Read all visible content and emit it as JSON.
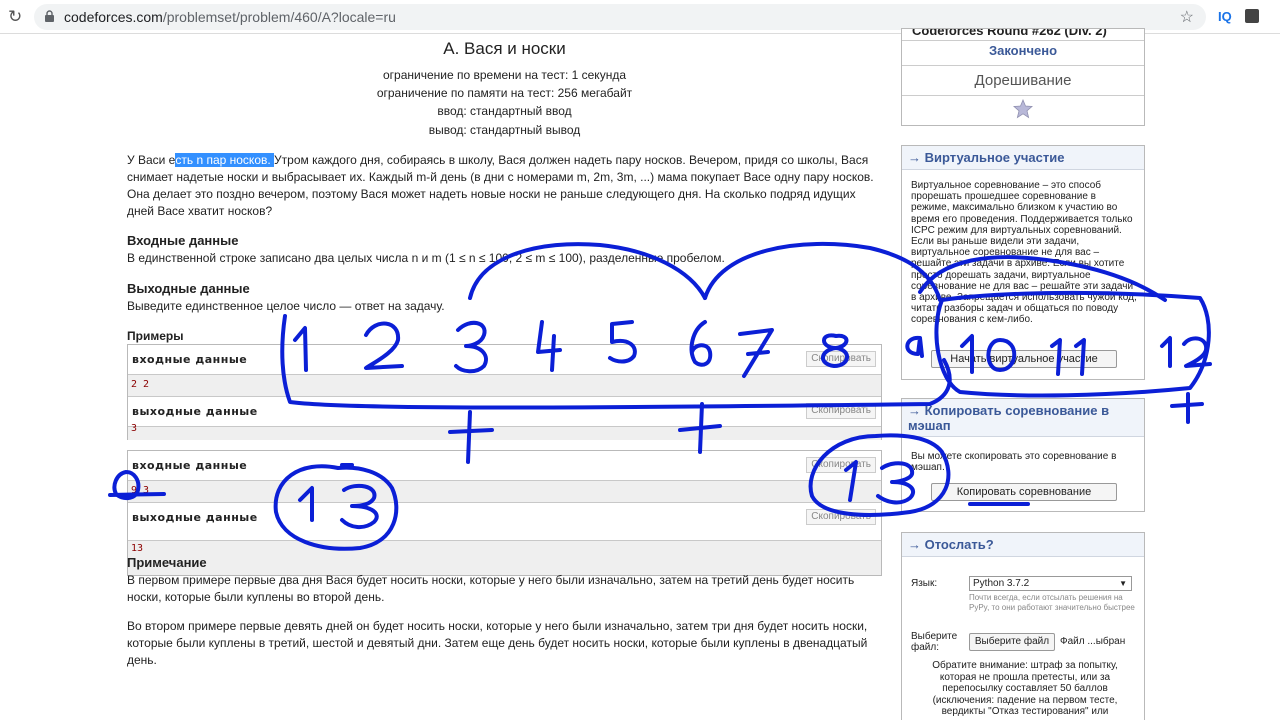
{
  "browser": {
    "url_host": "codeforces.com",
    "url_path": "/problemset/problem/460/A?locale=ru",
    "ext_iq": "IQ"
  },
  "problem": {
    "title": "A. Вася и носки",
    "time_limit": "ограничение по времени на тест: 1 секунда",
    "memory_limit": "ограничение по памяти на тест: 256 мегабайт",
    "input": "ввод: стандартный ввод",
    "output": "вывод: стандартный вывод",
    "legend_p1": "У Васи е",
    "legend_sel": "сть n пар носков. ",
    "legend_p2": "Утром каждого дня, собираясь в школу, Вася должен надеть пару носков. Вечером, придя со школы, Вася снимает надетые носки и выбрасывает их. Каждый m-й день (в дни с номерами m, 2m, 3m, ...) мама покупает Васе одну пару носков. Она делает это поздно вечером, поэтому Вася может надеть новые носки не раньше следующего дня. На сколько подряд идущих дней Васе хватит носков?",
    "input_title": "Входные данные",
    "input_text": "В единственной строке записано два целых числа n и m (1 ≤ n ≤ 100; 2 ≤ m ≤ 100), разделенные пробелом.",
    "output_title": "Выходные данные",
    "output_text": "Выведите единственное целое число — ответ на задачу.",
    "examples_title": "Примеры",
    "input_label": "входные данные",
    "output_label": "выходные данные",
    "copy_label": "Скопировать",
    "samples": [
      {
        "input": "2 2",
        "output": "3"
      },
      {
        "input": "9 3",
        "output": "13"
      }
    ],
    "note_title": "Примечание",
    "note_p1": "В первом примере первые два дня Вася будет носить носки, которые у него были изначально, затем на третий день будет носить носки, которые были куплены во второй день.",
    "note_p2": "Во втором примере первые девять дней он будет носить носки, которые у него были изначально, затем три дня будет носить носки, которые были куплены в третий, шестой и девятый дни. Затем еще день будет носить носки, которые были куплены в двенадцатый день."
  },
  "sidebar": {
    "contest_name": "Codeforces Round #262 (Div. 2)",
    "status": "Закончено",
    "practice": "Дорешивание",
    "virtual_title": "→ Виртуальное участие",
    "virtual_text": "Виртуальное соревнование – это способ прорешать прошедшее соревнование в режиме, максимально близком к участию во время его проведения. Поддерживается только ICPC режим для виртуальных соревнований. Если вы раньше видели эти задачи, виртуальное соревнование не для вас – решайте эти задачи в архиве. Если вы хотите просто дорешать задачи, виртуальное соревнование не для вас – решайте эти задачи в архиве. Запрещается использовать чужой код, читать разборы задач и общаться по поводу соревнования с кем-либо.",
    "virtual_button": "Начать виртуальное участие",
    "copy_title": "→ Копировать соревнование в мэшап",
    "copy_text": "Вы можете скопировать это соревнование в мэшап.",
    "copy_button": "Копировать соревнование",
    "submit_title": "→ Отослать?",
    "lang_label": "Язык:",
    "lang_value": "Python 3.7.2",
    "lang_hint": "Почти всегда, если отсылать решения на PyPy, то они работают значительно быстрее",
    "file_label": "Выберите файл:",
    "file_button": "Выберите файл",
    "file_status": "Файл ...ыбран",
    "attention": "Обратите внимание: штраф за попытку, которая не прошла претесты, или за перепосылку составляет 50 баллов (исключения: падение на первом тесте, вердикты \"Отказ тестирования\" или"
  },
  "annotations": {
    "numbers": [
      "1",
      "2",
      "3",
      "4",
      "5",
      "6",
      "7",
      "8",
      "9",
      "10",
      "11",
      "12"
    ],
    "plus_marks": [
      "+",
      "+",
      "+"
    ],
    "answer_left": "13",
    "answer_right": "13",
    "ink_color": "#0b1fd6"
  }
}
